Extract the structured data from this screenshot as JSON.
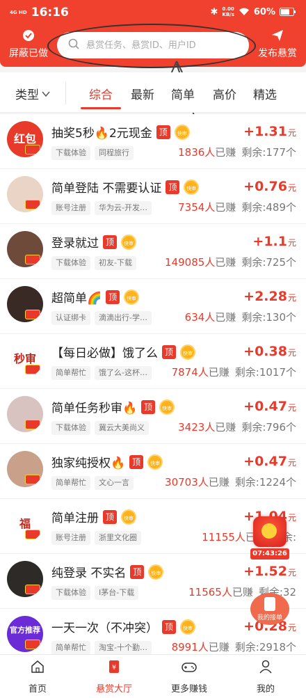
{
  "status_bar": {
    "network": "4G HD",
    "time": "16:16",
    "speed_value": "0.00",
    "speed_unit": "KB/s",
    "battery": "60%"
  },
  "header": {
    "left_button": "屏蔽已做",
    "search_placeholder": "悬赏任务、悬赏ID、用户ID",
    "right_button": "发布悬赏"
  },
  "filters": {
    "type_label": "类型",
    "tabs": [
      "综合",
      "最新",
      "简单",
      "高价",
      "精选"
    ],
    "active_tab": "综合"
  },
  "badges": {
    "ding": "顶",
    "kuai": "快审"
  },
  "tasks": [
    {
      "avatar_text": "红包",
      "avatar_color": "#e83a2b",
      "title": "抽奖5秒🔥2元现金",
      "reward": "+1.31",
      "unit": "元",
      "tags": [
        "下载体验",
        "同程旅行"
      ],
      "earned": "1836人",
      "earned_suffix": "已赚",
      "remaining": "剩余:177个",
      "kuai": true
    },
    {
      "avatar_text": "",
      "avatar_color": "#e9d4c6",
      "title": "简单登陆 不需要认证",
      "reward": "+0.76",
      "unit": "元",
      "tags": [
        "账号注册",
        "华为云-开发…"
      ],
      "earned": "7354人",
      "earned_suffix": "已赚",
      "remaining": "剩余:489个",
      "kuai": true
    },
    {
      "avatar_text": "",
      "avatar_color": "#6e4a3a",
      "title": "登录就过",
      "reward": "+1.1",
      "unit": "元",
      "tags": [
        "下载体验",
        "初友-下载"
      ],
      "earned": "149085人",
      "earned_suffix": "已赚",
      "remaining": "剩余:725个",
      "kuai": true
    },
    {
      "avatar_text": "",
      "avatar_color": "#3a2a26",
      "title": "超简单🌈",
      "reward": "+2.28",
      "unit": "元",
      "tags": [
        "认证绑卡",
        "滴滴出行-学…"
      ],
      "earned": "634人",
      "earned_suffix": "已赚",
      "remaining": "剩余:130个",
      "kuai": true
    },
    {
      "avatar_text": "秒审",
      "avatar_color": "#ffffff",
      "title": "【每日必做】饿了么",
      "reward": "+0.38",
      "unit": "元",
      "tags": [
        "简单帮忙",
        "饿了么-这杯…"
      ],
      "earned": "7874人",
      "earned_suffix": "已赚",
      "remaining": "剩余:1017个",
      "kuai": true
    },
    {
      "avatar_text": "",
      "avatar_color": "#d8c3c0",
      "title": "简单任务秒审🔥",
      "reward": "+0.47",
      "unit": "元",
      "tags": [
        "下载体验",
        "冀云大美尚义"
      ],
      "earned": "3423人",
      "earned_suffix": "已赚",
      "remaining": "剩余:796个",
      "kuai": true
    },
    {
      "avatar_text": "",
      "avatar_color": "#c9a08a",
      "title": "独家纯授权🔥",
      "reward": "+0.47",
      "unit": "元",
      "tags": [
        "简单帮忙",
        "文心一言"
      ],
      "earned": "30703人",
      "earned_suffix": "已赚",
      "remaining": "剩余:1224个",
      "kuai": true
    },
    {
      "avatar_text": "福",
      "avatar_color": "#ffffff",
      "title": "简单注册",
      "reward": "+1.04",
      "unit": "元",
      "tags": [
        "账号注册",
        "浙里文化圈"
      ],
      "earned": "11155人",
      "earned_suffix": "已赚",
      "remaining": "剩余:",
      "kuai": true
    },
    {
      "avatar_text": "",
      "avatar_color": "#2d2a28",
      "title": "纯登录 不实名",
      "reward": "+1.52",
      "unit": "元",
      "tags": [
        "下载体验",
        "I茅台-下载"
      ],
      "earned": "11565人",
      "earned_suffix": "已赚",
      "remaining": "剩余:32",
      "kuai": true
    },
    {
      "avatar_text": "官方推荐",
      "avatar_color": "#6b2bd6",
      "title": "一天一次（不冲突）",
      "reward": "+0.28",
      "unit": "元",
      "tags": [
        "简单帮忙",
        "淘宝-十个勤…"
      ],
      "earned": "8991人",
      "earned_suffix": "已赚",
      "remaining": "剩余:2918个",
      "kuai": true
    }
  ],
  "floating": {
    "timer": "07:43:26",
    "my_orders": "我的接单"
  },
  "bottom_nav": [
    {
      "label": "首页",
      "icon": "home-icon",
      "active": false
    },
    {
      "label": "悬赏大厅",
      "icon": "reward-hall-icon",
      "active": true
    },
    {
      "label": "更多赚钱",
      "icon": "gamepad-icon",
      "active": false
    },
    {
      "label": "我的",
      "icon": "profile-icon",
      "active": false
    }
  ],
  "colors": {
    "brand_red": "#f0412e",
    "accent_red": "#e8392a",
    "kuai_orange": "#ffb21c"
  }
}
